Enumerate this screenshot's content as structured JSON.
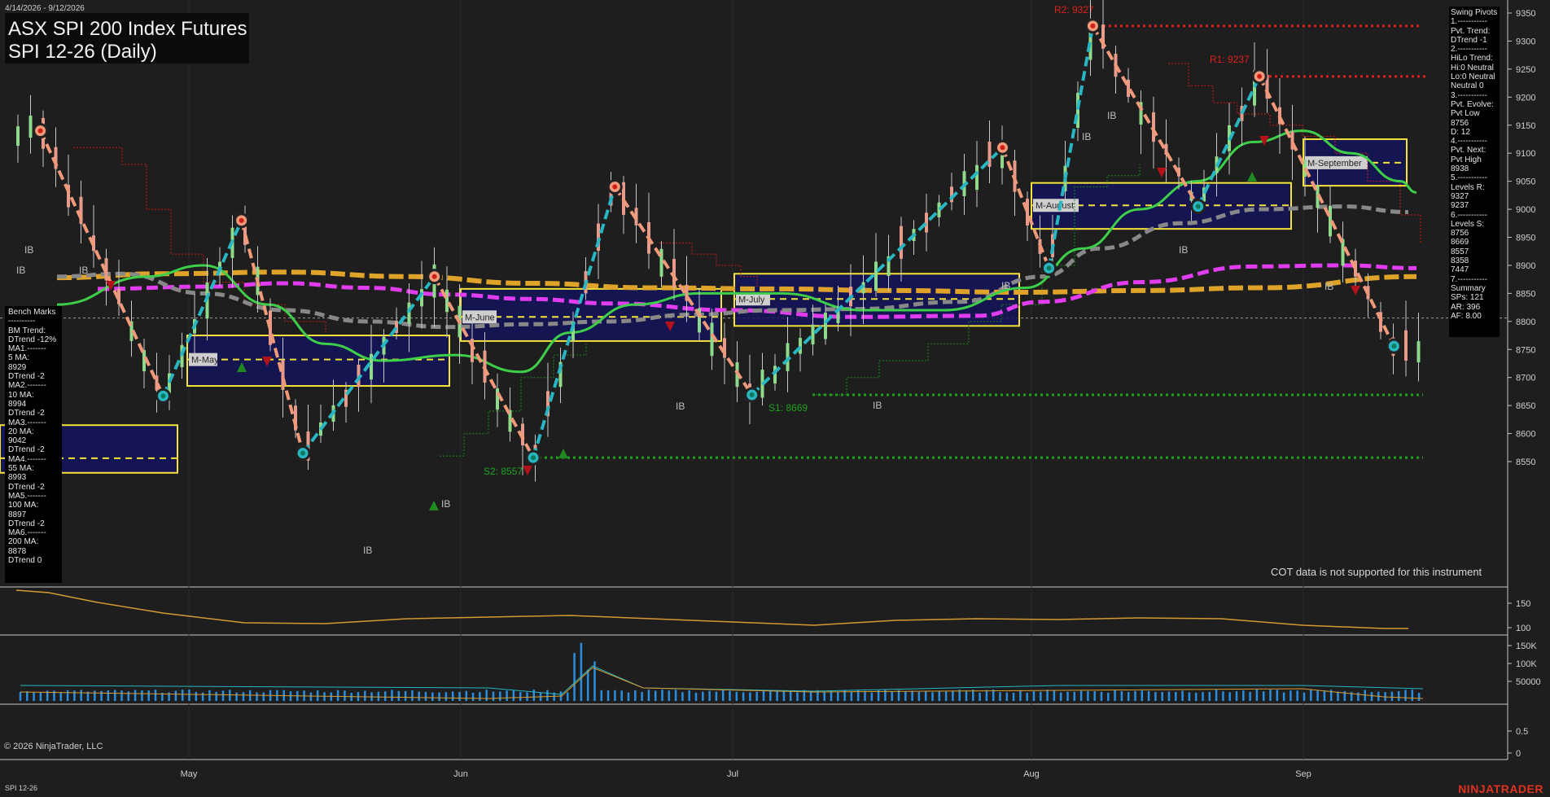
{
  "header": {
    "date_range": "4/14/2026 - 9/12/2026",
    "title": "ASX SPI 200 Index Futures",
    "subtitle": "SPI 12-26 (Daily)"
  },
  "bench_marks": {
    "lines": [
      "Bench Marks",
      "----------",
      "BM Trend:",
      "DTrend -12%",
      "MA1.-------",
      "5 MA:",
      "8929",
      "DTrend -2",
      "MA2.-------",
      "10 MA:",
      "8994",
      "DTrend -2",
      "MA3.-------",
      "20 MA:",
      "9042",
      "DTrend -2",
      "MA4.-------",
      "55 MA:",
      "8993",
      "DTrend -2",
      "MA5.-------",
      "100 MA:",
      "8897",
      "DTrend -2",
      "MA6.-------",
      "200 MA:",
      "8878",
      "DTrend 0"
    ]
  },
  "swing_pivots": {
    "lines": [
      "Swing Pivots",
      "1.-----------",
      "Pvt. Trend:",
      "DTrend -1",
      "2.-----------",
      "HiLo Trend:",
      "Hi:0 Neutral",
      "Lo:0 Neutral",
      "Neutral 0",
      "3.-----------",
      "Pvt. Evolve:",
      "Pvt Low",
      "8756",
      "D: 12",
      "4.-----------",
      "Pvt. Next:",
      "Pvt High",
      "8938",
      "5.-----------",
      "Levels R:",
      "9327",
      "9237",
      "6.-----------",
      "Levels S:",
      "8756",
      "8669",
      "8557",
      "8358",
      "7447",
      "7.-----------",
      "Summary",
      "SPs: 121",
      "AR: 396",
      "AF: 8.00"
    ]
  },
  "labels": {
    "r2": "R2: 9327",
    "r1": "R1: 9237",
    "s1": "S1: 8669",
    "s2": "S2: 8557",
    "ib": "IB",
    "cot": "COT data is not supported for this instrument",
    "copyright": "© 2026 NinjaTrader, LLC",
    "instrument": "SPI 12-26",
    "brand": "NINJATRADER"
  },
  "chart_data": {
    "type": "candlestick",
    "price_axis": {
      "ticks": [
        9350,
        9300,
        9250,
        9200,
        9150,
        9100,
        9050,
        9000,
        8950,
        8900,
        8850,
        8800,
        8750,
        8700,
        8650,
        8600,
        8550
      ],
      "range": [
        8525,
        9370
      ]
    },
    "time_axis": {
      "labels": [
        "May",
        "Jun",
        "Jul",
        "Aug",
        "Sep"
      ]
    },
    "osc_axis": {
      "ticks": [
        "150",
        "100"
      ]
    },
    "volume_axis": {
      "ticks": [
        "150K",
        "100K",
        "50000"
      ]
    },
    "cot_axis": {
      "ticks": [
        "0.5",
        "0"
      ]
    },
    "resistance": [
      {
        "name": "R2",
        "value": 9327
      },
      {
        "name": "R1",
        "value": 9237
      }
    ],
    "support": [
      {
        "name": "S1",
        "value": 8669
      },
      {
        "name": "S2",
        "value": 8557
      }
    ],
    "current_price": 8806,
    "last_close": 8756,
    "monthly_value_areas": [
      {
        "label": "M-May",
        "high": 8775,
        "low": 8685,
        "mid": 8732
      },
      {
        "label": "M-June",
        "high": 8858,
        "low": 8765,
        "mid": 8808
      },
      {
        "label": "M-July",
        "high": 8885,
        "low": 8792,
        "mid": 8840
      },
      {
        "label": "M-August",
        "high": 9047,
        "low": 8965,
        "mid": 9007
      },
      {
        "label": "M-September",
        "high": 9125,
        "low": 9042,
        "mid": 9083
      }
    ],
    "swing_points": [
      {
        "date": "Apr 15",
        "price": 9140,
        "kind": "high"
      },
      {
        "date": "Apr 29",
        "price": 8667,
        "kind": "low"
      },
      {
        "date": "May 7",
        "price": 8980,
        "kind": "high"
      },
      {
        "date": "May 14",
        "price": 8565,
        "kind": "low"
      },
      {
        "date": "May 29",
        "price": 8880,
        "kind": "high"
      },
      {
        "date": "Jun 9",
        "price": 8557,
        "kind": "low"
      },
      {
        "date": "Jun 18",
        "price": 9040,
        "kind": "high"
      },
      {
        "date": "Jul 3",
        "price": 8669,
        "kind": "low"
      },
      {
        "date": "Jul 29",
        "price": 9110,
        "kind": "high"
      },
      {
        "date": "Aug 3",
        "price": 8895,
        "kind": "low"
      },
      {
        "date": "Aug 8",
        "price": 9327,
        "kind": "high"
      },
      {
        "date": "Aug 20",
        "price": 9005,
        "kind": "low"
      },
      {
        "date": "Aug 27",
        "price": 9237,
        "kind": "high"
      },
      {
        "date": "Sep 11",
        "price": 8756,
        "kind": "low"
      }
    ],
    "moving_averages": [
      {
        "name": "20 MA",
        "color": "#3ecf4a"
      },
      {
        "name": "55 MA",
        "color": "#888888"
      },
      {
        "name": "100 MA",
        "color": "#e23cf0"
      },
      {
        "name": "200 MA",
        "color": "#e0a32a"
      }
    ]
  }
}
